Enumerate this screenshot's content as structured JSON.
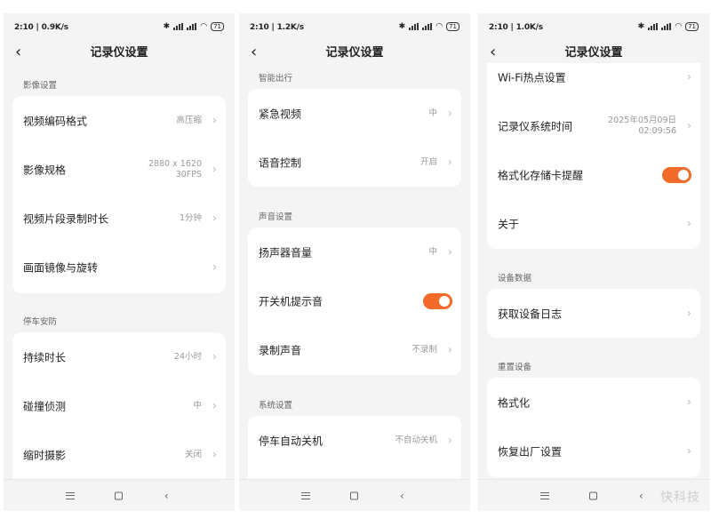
{
  "colors": {
    "accent": "#f26b2a",
    "page_bg": "#f4f4f4",
    "card_bg": "#ffffff"
  },
  "phones": [
    {
      "status": {
        "time": "2:10",
        "speed": "0.9K/s",
        "battery": "71"
      },
      "title": "记录仪设置",
      "sections": [
        {
          "label": "影像设置",
          "rows": [
            {
              "label": "视频编码格式",
              "value": "高压缩"
            },
            {
              "label": "影像规格",
              "value_line1": "2880 x 1620",
              "value_line2": "30FPS"
            },
            {
              "label": "视频片段录制时长",
              "value": "1分钟"
            },
            {
              "label": "画面镜像与旋转"
            }
          ]
        },
        {
          "label": "停车安防",
          "rows": [
            {
              "label": "持续时长",
              "value": "24小时"
            },
            {
              "label": "碰撞侦测",
              "value": "中"
            },
            {
              "label": "缩时摄影",
              "value": "关闭"
            }
          ]
        }
      ]
    },
    {
      "status": {
        "time": "2:10",
        "speed": "1.2K/s",
        "battery": "71"
      },
      "title": "记录仪设置",
      "sections": [
        {
          "label": "智能出行",
          "rows": [
            {
              "label": "紧急视频",
              "value": "中"
            },
            {
              "label": "语音控制",
              "value": "开启"
            }
          ]
        },
        {
          "label": "声音设置",
          "rows": [
            {
              "label": "扬声器音量",
              "value": "中"
            },
            {
              "label": "开关机提示音",
              "toggle": "on"
            },
            {
              "label": "录制声音",
              "value": "不录制"
            }
          ]
        },
        {
          "label": "系统设置",
          "rows": [
            {
              "label": "停车自动关机",
              "value": "不自动关机"
            }
          ]
        }
      ]
    },
    {
      "status": {
        "time": "2:10",
        "speed": "1.0K/s",
        "battery": "71"
      },
      "title": "记录仪设置",
      "sections": [
        {
          "rows": [
            {
              "label": "Wi-Fi热点设置"
            },
            {
              "label": "记录仪系统时间",
              "value_line1": "2025年05月09日",
              "value_line2": "02:09:56"
            },
            {
              "label": "格式化存储卡提醒",
              "toggle": "on"
            },
            {
              "label": "关于"
            }
          ]
        },
        {
          "label": "设备数据",
          "rows": [
            {
              "label": "获取设备日志"
            }
          ]
        },
        {
          "label": "重置设备",
          "rows": [
            {
              "label": "格式化"
            },
            {
              "label": "恢复出厂设置"
            }
          ]
        }
      ]
    }
  ],
  "watermark": "快科技"
}
